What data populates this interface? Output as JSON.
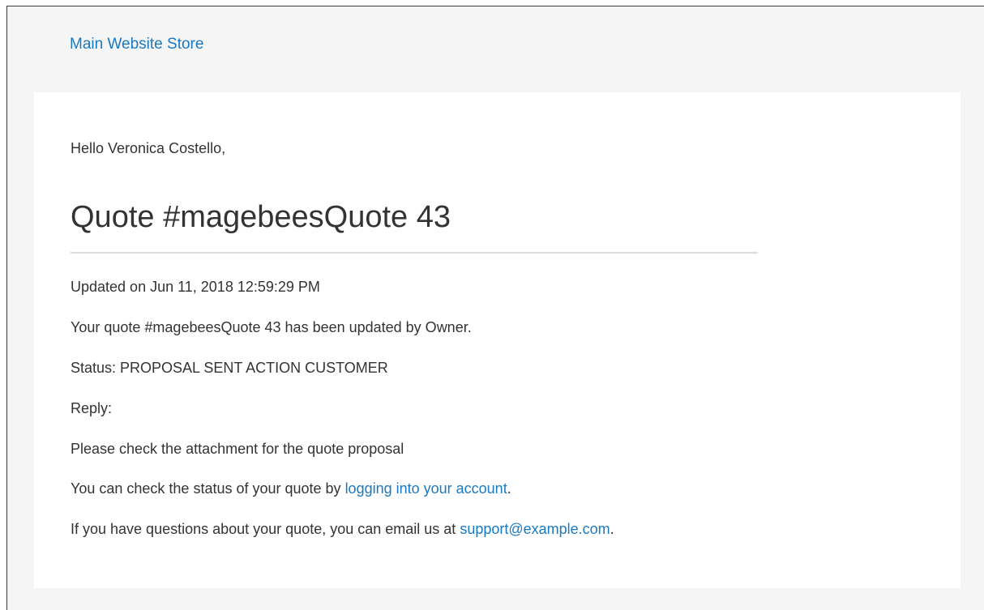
{
  "header": {
    "store_link": "Main Website Store"
  },
  "email": {
    "greeting": "Hello Veronica Costello,",
    "title": "Quote #magebeesQuote 43",
    "updated": "Updated on Jun 11, 2018 12:59:29 PM",
    "update_message": "Your quote #magebeesQuote 43 has been updated by Owner.",
    "status": "Status: PROPOSAL SENT ACTION CUSTOMER",
    "reply_label": "Reply:",
    "reply_body": "Please check the attachment for the quote proposal",
    "account_text": "You can check the status of your quote by ",
    "account_link": "logging into your account",
    "account_suffix": ".",
    "questions_text": "If you have questions about your quote, you can email us at ",
    "support_email": "support@example.com",
    "questions_suffix": "."
  },
  "colors": {
    "link": "#1979c3",
    "text": "#333333",
    "background": "#f5f5f5",
    "card": "#ffffff"
  }
}
